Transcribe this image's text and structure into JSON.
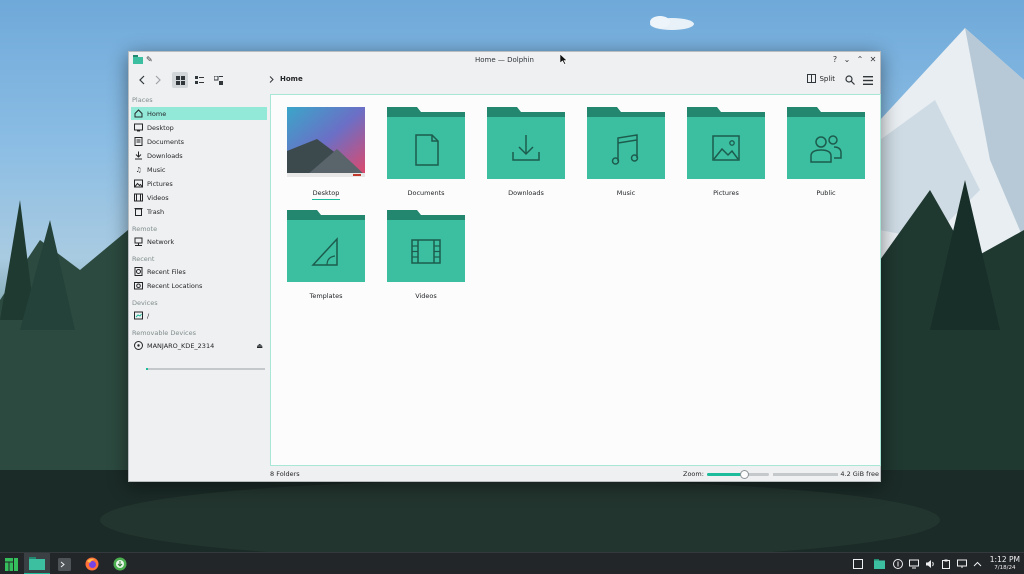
{
  "window": {
    "title": "Home — Dolphin",
    "controls": [
      "?",
      "⌄",
      "⌃",
      "✕"
    ]
  },
  "toolbar": {
    "breadcrumb": "Home",
    "split_label": "Split"
  },
  "sidebar": {
    "sections": [
      {
        "heading": "Places",
        "items": [
          {
            "label": "Home",
            "icon": "home-icon",
            "active": true
          },
          {
            "label": "Desktop",
            "icon": "desktop-icon"
          },
          {
            "label": "Documents",
            "icon": "documents-icon"
          },
          {
            "label": "Downloads",
            "icon": "downloads-icon"
          },
          {
            "label": "Music",
            "icon": "music-icon"
          },
          {
            "label": "Pictures",
            "icon": "pictures-icon"
          },
          {
            "label": "Videos",
            "icon": "videos-icon"
          },
          {
            "label": "Trash",
            "icon": "trash-icon"
          }
        ]
      },
      {
        "heading": "Remote",
        "items": [
          {
            "label": "Network",
            "icon": "network-icon"
          }
        ]
      },
      {
        "heading": "Recent",
        "items": [
          {
            "label": "Recent Files",
            "icon": "recent-files-icon"
          },
          {
            "label": "Recent Locations",
            "icon": "recent-locations-icon"
          }
        ]
      },
      {
        "heading": "Devices",
        "items": [
          {
            "label": "/",
            "icon": "drive-icon",
            "usage_fraction": 0.02
          }
        ]
      },
      {
        "heading": "Removable Devices",
        "items": [
          {
            "label": "MANJARO_KDE_2314",
            "icon": "optical-disc-icon"
          }
        ]
      }
    ]
  },
  "folders": [
    {
      "label": "Desktop",
      "icon": "desktop-preview"
    },
    {
      "label": "Documents",
      "icon": "document-icon"
    },
    {
      "label": "Downloads",
      "icon": "download-icon"
    },
    {
      "label": "Music",
      "icon": "music-note-icon"
    },
    {
      "label": "Pictures",
      "icon": "picture-icon"
    },
    {
      "label": "Public",
      "icon": "users-icon"
    },
    {
      "label": "Templates",
      "icon": "template-icon"
    },
    {
      "label": "Videos",
      "icon": "film-icon"
    }
  ],
  "status": {
    "folder_count": "8 Folders",
    "zoom_label": "Zoom:",
    "zoom_fraction": 0.6,
    "free_space": "4.2 GiB free"
  },
  "taskbar": {
    "clock_time": "1:12 PM",
    "clock_date": "7/18/24"
  },
  "colors": {
    "accent": "#1abc9c",
    "folder": "#3cbfa1",
    "folder_dark": "#23876f",
    "selection": "#93e9d8",
    "taskbar": "#232629"
  }
}
